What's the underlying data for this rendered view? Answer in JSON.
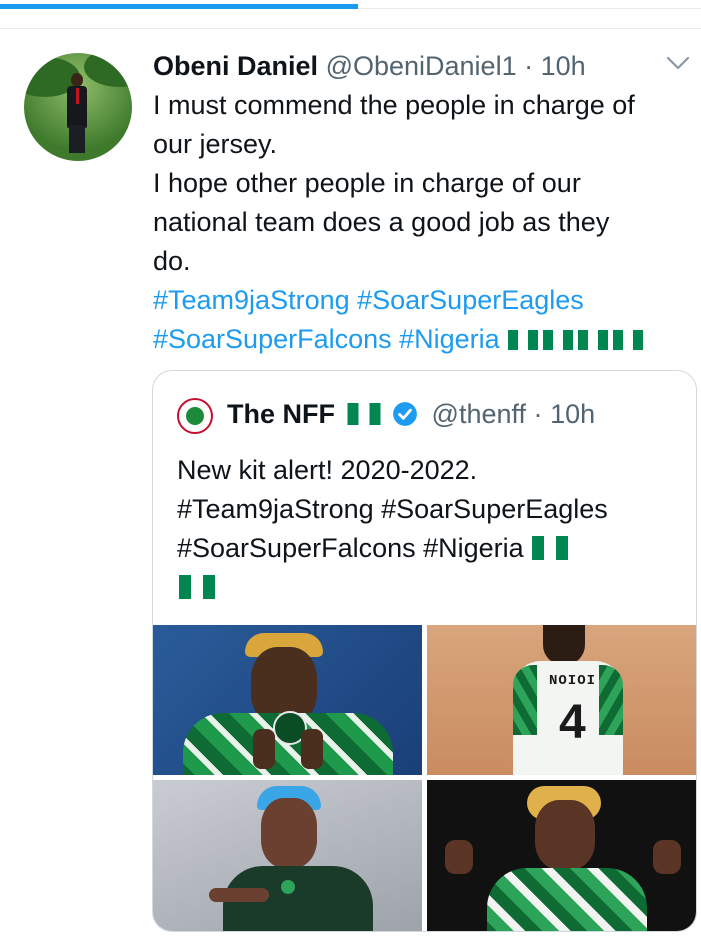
{
  "tweet": {
    "author_name": "Obeni Daniel",
    "handle": "@ObeniDaniel1",
    "separator": "·",
    "time": "10h",
    "lines": [
      "I must commend the people in charge of",
      "our jersey.",
      "I hope other people in charge of our",
      "national team does a good job as they",
      "do."
    ],
    "hashtags_line1": "#Team9jaStrong #SoarSuperEagles",
    "hashtags_line2": "#SoarSuperFalcons #Nigeria",
    "flag_count": 4
  },
  "quote": {
    "author_name": "The NFF",
    "handle": "@thenff",
    "separator": "·",
    "time": "10h",
    "lines": [
      "New kit alert! 2020-2022.",
      "#Team9jaStrong #SoarSuperEagles",
      "#SoarSuperFalcons #Nigeria"
    ],
    "media": [
      {
        "icon": "player-kissing-badge-photo"
      },
      {
        "icon": "player-back-jersey-photo",
        "jersey_name": "NOIOI",
        "jersey_number": "4"
      },
      {
        "icon": "player-pointing-photo"
      },
      {
        "icon": "player-celebrating-photo"
      }
    ]
  },
  "colors": {
    "accent": "#1d9bf0",
    "text": "#0f1419",
    "muted": "#536471",
    "border": "#cfd9de",
    "flag_green": "#008751"
  },
  "progress": {
    "fraction": 0.51
  }
}
